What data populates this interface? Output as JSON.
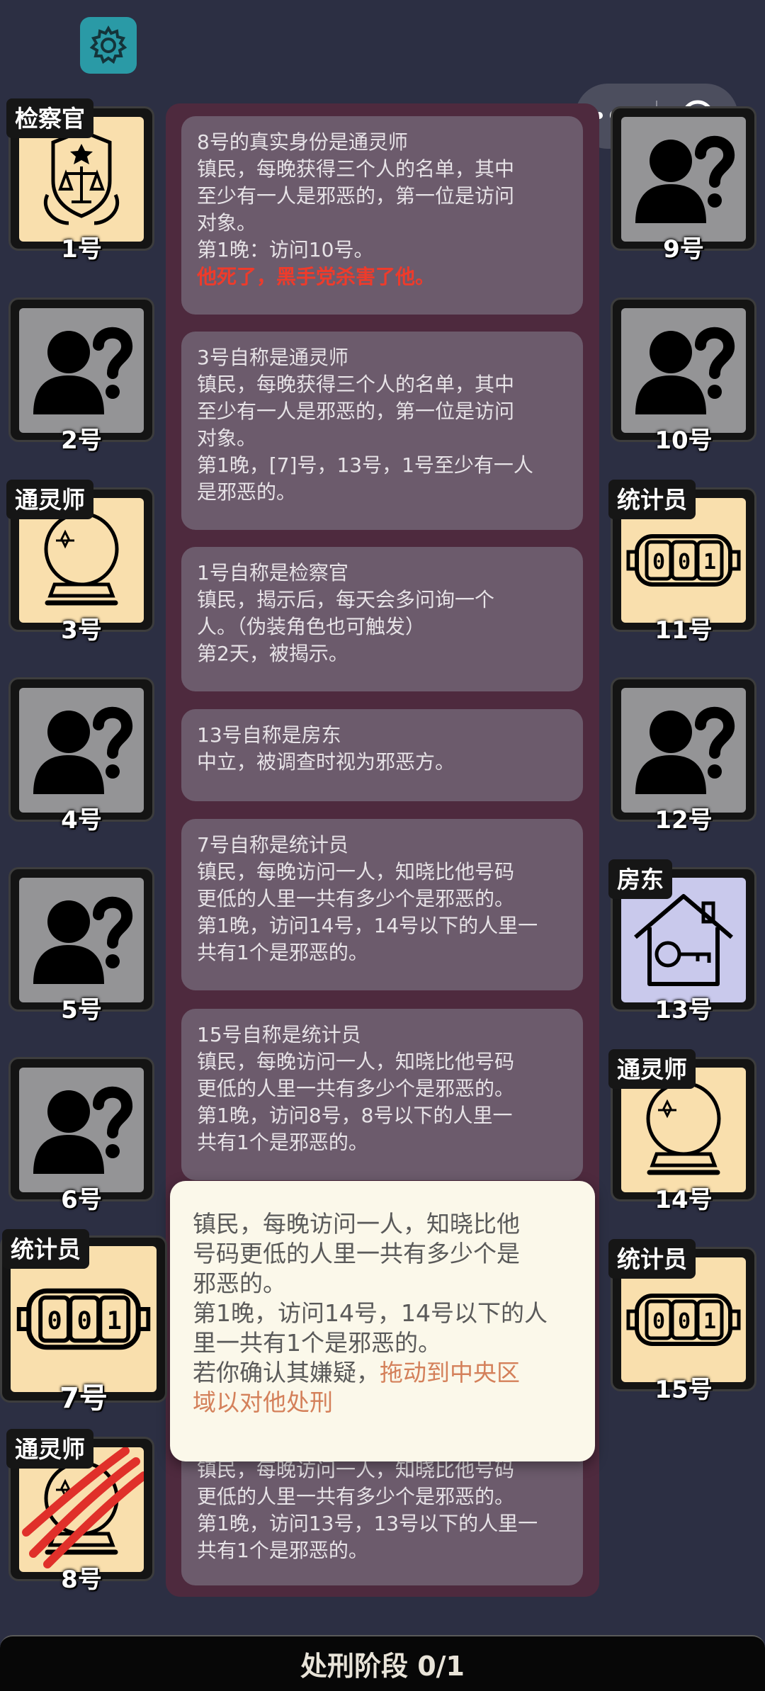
{
  "capsule": {
    "more": "more-icon",
    "close": "target-icon"
  },
  "cards": [
    {
      "num": "1号",
      "role": "检察官",
      "icon": "scales-badge-icon"
    },
    {
      "num": "2号",
      "role": "",
      "icon": "unknown-person-icon"
    },
    {
      "num": "3号",
      "role": "通灵师",
      "icon": "crystal-ball-icon"
    },
    {
      "num": "4号",
      "role": "",
      "icon": "unknown-person-icon"
    },
    {
      "num": "5号",
      "role": "",
      "icon": "unknown-person-icon"
    },
    {
      "num": "6号",
      "role": "",
      "icon": "unknown-person-icon"
    },
    {
      "num": "7号",
      "role": "统计员",
      "icon": "counter-icon"
    },
    {
      "num": "8号",
      "role": "通灵师",
      "icon": "claw-crystal-ball-icon"
    },
    {
      "num": "9号",
      "role": "",
      "icon": "unknown-person-icon"
    },
    {
      "num": "10号",
      "role": "",
      "icon": "unknown-person-icon"
    },
    {
      "num": "11号",
      "role": "统计员",
      "icon": "counter-icon"
    },
    {
      "num": "12号",
      "role": "",
      "icon": "unknown-person-icon"
    },
    {
      "num": "13号",
      "role": "房东",
      "icon": "house-key-icon"
    },
    {
      "num": "14号",
      "role": "通灵师",
      "icon": "crystal-ball-icon"
    },
    {
      "num": "15号",
      "role": "统计员",
      "icon": "counter-icon"
    }
  ],
  "counter_text": "001",
  "log": [
    {
      "lines": [
        "8号的真实身份是通灵师",
        "镇民，每晚获得三个人的名单，其中",
        "至少有一人是邪恶的，第一位是访问",
        "对象。",
        "第1晚：访问10号。"
      ],
      "red": "他死了，黑手党杀害了他。"
    },
    {
      "lines": [
        "3号自称是通灵师",
        "镇民，每晚获得三个人的名单，其中",
        "至少有一人是邪恶的，第一位是访问",
        "对象。",
        "第1晚，[7]号，13号，1号至少有一人",
        "是邪恶的。"
      ]
    },
    {
      "lines": [
        "1号自称是检察官",
        "镇民，揭示后，每天会多问询一个",
        "人。（伪装角色也可触发）",
        "第2天，被揭示。"
      ]
    },
    {
      "lines": [
        "13号自称是房东",
        "中立，被调查时视为邪恶方。"
      ]
    },
    {
      "lines": [
        "7号自称是统计员",
        "镇民，每晚访问一人，知晓比他号码",
        "更低的人里一共有多少个是邪恶的。",
        "第1晚，访问14号，14号以下的人里一",
        "共有1个是邪恶的。"
      ]
    },
    {
      "lines": [
        "15号自称是统计员",
        "镇民，每晚访问一人，知晓比他号码",
        "更低的人里一共有多少个是邪恶的。",
        "第1晚，访问8号，8号以下的人里一",
        "共有1个是邪恶的。"
      ]
    },
    {
      "lines": [
        "镇民，每晚访问一人，知晓比他号码",
        "更低的人里一共有多少个是邪恶的。",
        "第1晚，访问13号，13号以下的人里一",
        "共有1个是邪恶的。"
      ]
    }
  ],
  "popup": {
    "lines": [
      "镇民，每晚访问一人，知晓比他",
      "号码更低的人里一共有多少个是",
      "邪恶的。",
      "第1晚，访问14号，14号以下的人",
      "里一共有1个是邪恶的。"
    ],
    "prefix": "若你确认其嫌疑，",
    "highlight1": "拖动到中央区",
    "highlight2": "域以对他处刑"
  },
  "bottom": {
    "label": "处刑阶段 0/1"
  }
}
